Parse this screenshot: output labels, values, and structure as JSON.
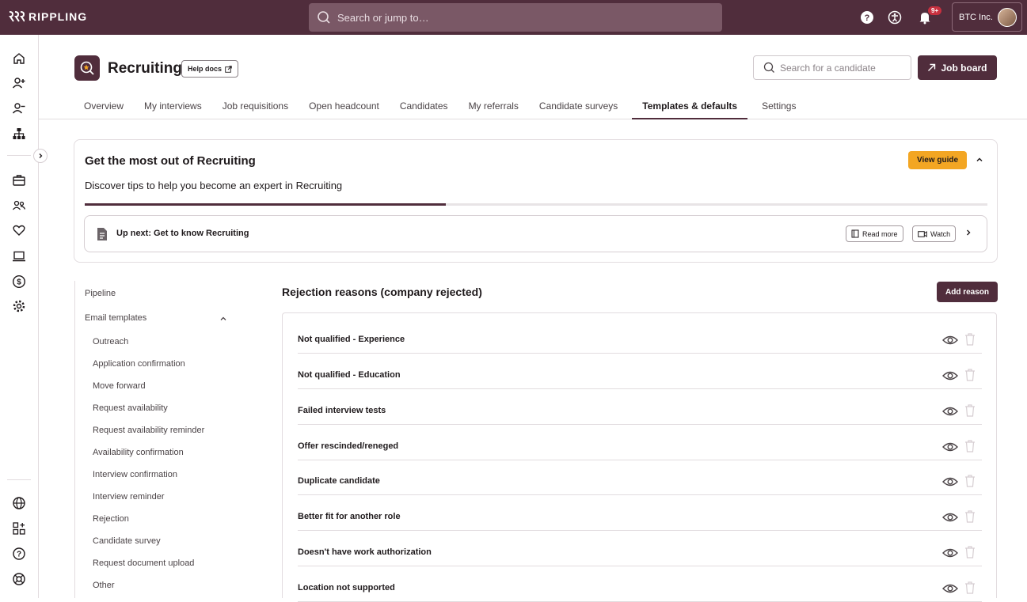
{
  "topbar": {
    "logo_text": "RIPPLING",
    "search_placeholder": "Search or jump to…",
    "notification_badge": "9+",
    "company_name": "BTC Inc.",
    "icons": [
      "help-icon",
      "accessibility-icon",
      "bell-icon"
    ]
  },
  "leftnav": {
    "items": [
      "home-icon",
      "add-person-icon",
      "remove-person-icon",
      "org-chart-icon",
      "briefcase-icon",
      "team-icon",
      "heart-icon",
      "laptop-icon",
      "dollar-icon",
      "gear-icon"
    ],
    "bottom_items": [
      "globe-icon",
      "apps-icon",
      "help-icon",
      "support-icon"
    ]
  },
  "header": {
    "title": "Recruiting",
    "help_docs_label": "Help docs",
    "candidate_search_placeholder": "Search for a candidate",
    "job_board_label": "Job board",
    "tabs": [
      {
        "label": "Overview",
        "active": false
      },
      {
        "label": "My interviews",
        "active": false
      },
      {
        "label": "Job requisitions",
        "active": false
      },
      {
        "label": "Open headcount",
        "active": false
      },
      {
        "label": "Candidates",
        "active": false
      },
      {
        "label": "My referrals",
        "active": false
      },
      {
        "label": "Candidate surveys",
        "active": false
      },
      {
        "label": "Templates & defaults",
        "active": true
      },
      {
        "label": "Settings",
        "active": false
      }
    ]
  },
  "guide": {
    "title": "Get the most out of Recruiting",
    "subtitle": "Discover tips to help you become an expert in Recruiting",
    "view_guide_label": "View guide",
    "progress_fraction": 0.4,
    "up_next": "Up next: Get to know Recruiting",
    "read_more_label": "Read more",
    "watch_label": "Watch"
  },
  "sidemenu": {
    "pipeline": "Pipeline",
    "email_templates": "Email templates",
    "sub_items": [
      "Outreach",
      "Application confirmation",
      "Move forward",
      "Request availability",
      "Request availability reminder",
      "Availability confirmation",
      "Interview confirmation",
      "Interview reminder",
      "Rejection",
      "Candidate survey",
      "Request document upload",
      "Other"
    ]
  },
  "main": {
    "title": "Rejection reasons (company rejected)",
    "add_reason_label": "Add reason",
    "reasons": [
      "Not qualified - Experience",
      "Not qualified - Education",
      "Failed interview tests",
      "Offer rescinded/reneged",
      "Duplicate candidate",
      "Better fit for another role",
      "Doesn't have work authorization",
      "Location not supported"
    ]
  },
  "colors": {
    "brand": "#502d3c",
    "accent": "#f3a623",
    "badge": "#c8303f"
  }
}
